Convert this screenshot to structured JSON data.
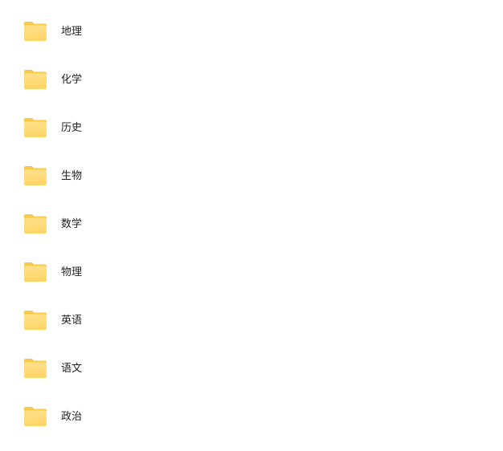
{
  "folder_list": {
    "items": [
      {
        "label": "地理",
        "icon": "folder-icon"
      },
      {
        "label": "化学",
        "icon": "folder-icon"
      },
      {
        "label": "历史",
        "icon": "folder-icon"
      },
      {
        "label": "生物",
        "icon": "folder-icon"
      },
      {
        "label": "数学",
        "icon": "folder-icon"
      },
      {
        "label": "物理",
        "icon": "folder-icon"
      },
      {
        "label": "英语",
        "icon": "folder-icon"
      },
      {
        "label": "语文",
        "icon": "folder-icon"
      },
      {
        "label": "政治",
        "icon": "folder-icon"
      }
    ]
  },
  "colors": {
    "folder_back": "#F9C94A",
    "folder_front_top": "#FFE08A",
    "folder_front_bottom": "#FFD566",
    "text": "#1F1F1F",
    "background": "#FFFFFF"
  }
}
